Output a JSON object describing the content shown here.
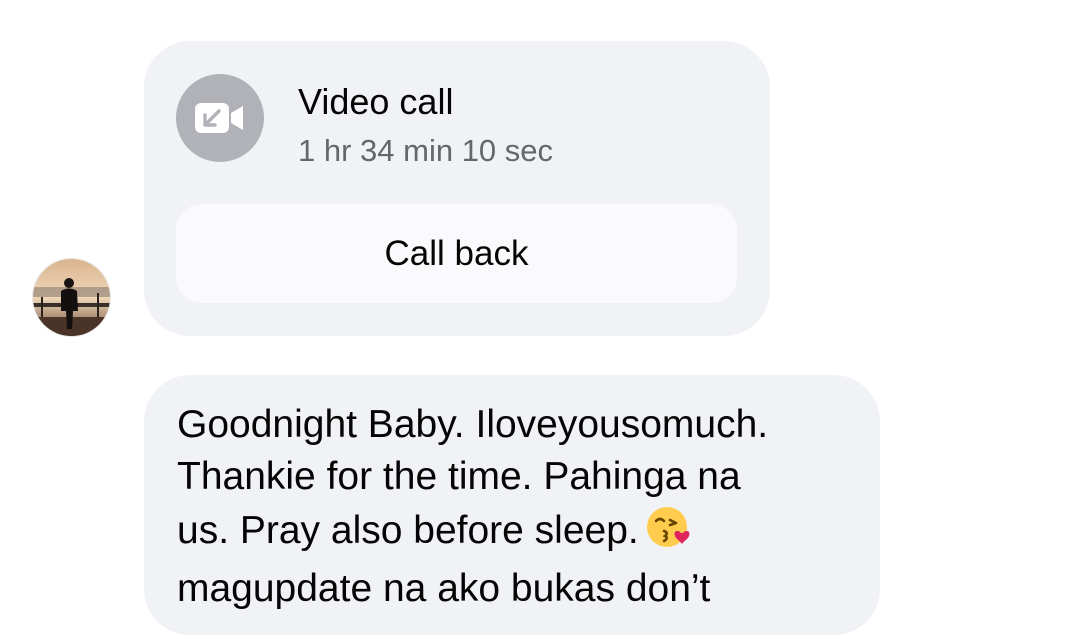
{
  "call_card": {
    "title": "Video call",
    "duration": "1 hr 34 min 10 sec",
    "call_back_label": "Call back",
    "icon": "video-camera-incoming-icon"
  },
  "message": {
    "lines": [
      "Goodnight Baby. Iloveyousomuch.",
      "Thankie for the time. Pahinga na",
      "us. Pray also before sleep.",
      "magupdate na ako bukas don’t"
    ],
    "emoji": "😘"
  },
  "colors": {
    "bubble_background": "#f1f2f6",
    "icon_background": "#b0b2b7",
    "secondary_text": "#65676b"
  }
}
